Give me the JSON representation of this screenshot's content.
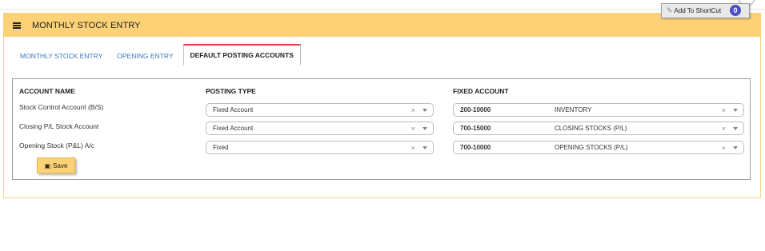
{
  "page": {
    "title": "MONTHLY STOCK ENTRY",
    "shortcut_label": "Add To ShortCut",
    "shortcut_count": "0"
  },
  "tabs": [
    {
      "label": "MONTHLY STOCK ENTRY",
      "active": false
    },
    {
      "label": "OPENING ENTRY",
      "active": false
    },
    {
      "label": "DEFAULT POSTING ACCOUNTS",
      "active": true
    }
  ],
  "table": {
    "headers": {
      "account_name": "ACCOUNT NAME",
      "posting_type": "POSTING TYPE",
      "fixed_account": "FIXED ACCOUNT"
    },
    "rows": [
      {
        "account_name": "Stock Control Account (B/S)",
        "posting_type": "Fixed Account",
        "account_code": "200-10000",
        "account_label": "INVENTORY"
      },
      {
        "account_name": "Closing P/L Stock Account",
        "posting_type": "Fixed Account",
        "account_code": "700-15000",
        "account_label": "CLOSING STOCKS (P/L)"
      },
      {
        "account_name": "Opening Stock (P&L) A/c",
        "posting_type": "Fixed",
        "account_code": "700-10000",
        "account_label": "OPENING STOCKS (P/L)"
      }
    ]
  },
  "actions": {
    "save_label": "Save"
  },
  "icons": {
    "menu": "hamburger-icon",
    "shortcut": "pencil-icon",
    "save": "floppy-disk-icon",
    "clear": "clear-x-icon",
    "dropdown": "caret-down-icon"
  },
  "colors": {
    "header_bg": "#fdd175",
    "active_tab_accent": "#e0424b",
    "tab_link": "#3a78b8",
    "badge": "#4b4fc4"
  }
}
